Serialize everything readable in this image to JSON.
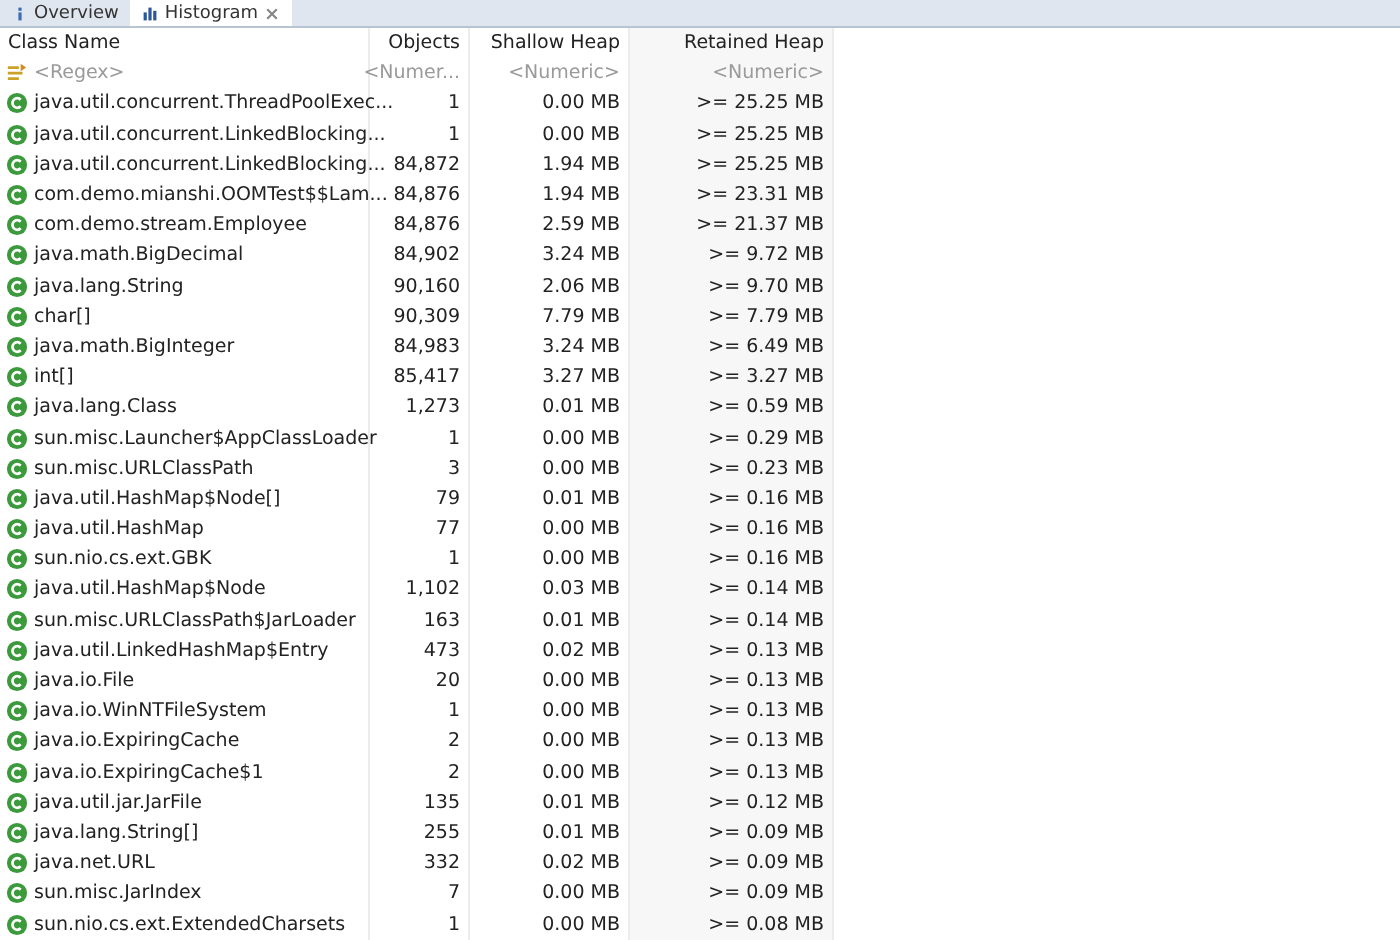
{
  "tabs": [
    {
      "label": "Overview",
      "selected": false,
      "closable": false
    },
    {
      "label": "Histogram",
      "selected": true,
      "closable": true
    }
  ],
  "table": {
    "columns": [
      "Class Name",
      "Objects",
      "Shallow Heap",
      "Retained Heap"
    ],
    "filters": [
      "<Regex>",
      "<Numer...",
      "<Numeric>",
      "<Numeric>"
    ],
    "rows": [
      [
        "java.util.concurrent.ThreadPoolExec...",
        "1",
        "0.00 MB",
        ">= 25.25 MB"
      ],
      [
        "java.util.concurrent.LinkedBlocking...",
        "1",
        "0.00 MB",
        ">= 25.25 MB"
      ],
      [
        "java.util.concurrent.LinkedBlocking...",
        "84,872",
        "1.94 MB",
        ">= 25.25 MB"
      ],
      [
        "com.demo.mianshi.OOMTest$$Lam...",
        "84,876",
        "1.94 MB",
        ">= 23.31 MB"
      ],
      [
        "com.demo.stream.Employee",
        "84,876",
        "2.59 MB",
        ">= 21.37 MB"
      ],
      [
        "java.math.BigDecimal",
        "84,902",
        "3.24 MB",
        ">= 9.72 MB"
      ],
      [
        "java.lang.String",
        "90,160",
        "2.06 MB",
        ">= 9.70 MB"
      ],
      [
        "char[]",
        "90,309",
        "7.79 MB",
        ">= 7.79 MB"
      ],
      [
        "java.math.BigInteger",
        "84,983",
        "3.24 MB",
        ">= 6.49 MB"
      ],
      [
        "int[]",
        "85,417",
        "3.27 MB",
        ">= 3.27 MB"
      ],
      [
        "java.lang.Class",
        "1,273",
        "0.01 MB",
        ">= 0.59 MB"
      ],
      [
        "sun.misc.Launcher$AppClassLoader",
        "1",
        "0.00 MB",
        ">= 0.29 MB"
      ],
      [
        "sun.misc.URLClassPath",
        "3",
        "0.00 MB",
        ">= 0.23 MB"
      ],
      [
        "java.util.HashMap$Node[]",
        "79",
        "0.01 MB",
        ">= 0.16 MB"
      ],
      [
        "java.util.HashMap",
        "77",
        "0.00 MB",
        ">= 0.16 MB"
      ],
      [
        "sun.nio.cs.ext.GBK",
        "1",
        "0.00 MB",
        ">= 0.16 MB"
      ],
      [
        "java.util.HashMap$Node",
        "1,102",
        "0.03 MB",
        ">= 0.14 MB"
      ],
      [
        "sun.misc.URLClassPath$JarLoader",
        "163",
        "0.01 MB",
        ">= 0.14 MB"
      ],
      [
        "java.util.LinkedHashMap$Entry",
        "473",
        "0.02 MB",
        ">= 0.13 MB"
      ],
      [
        "java.io.File",
        "20",
        "0.00 MB",
        ">= 0.13 MB"
      ],
      [
        "java.io.WinNTFileSystem",
        "1",
        "0.00 MB",
        ">= 0.13 MB"
      ],
      [
        "java.io.ExpiringCache",
        "2",
        "0.00 MB",
        ">= 0.13 MB"
      ],
      [
        "java.io.ExpiringCache$1",
        "2",
        "0.00 MB",
        ">= 0.13 MB"
      ],
      [
        "java.util.jar.JarFile",
        "135",
        "0.01 MB",
        ">= 0.12 MB"
      ],
      [
        "java.lang.String[]",
        "255",
        "0.01 MB",
        ">= 0.09 MB"
      ],
      [
        "java.net.URL",
        "332",
        "0.02 MB",
        ">= 0.09 MB"
      ],
      [
        "sun.misc.JarIndex",
        "7",
        "0.00 MB",
        ">= 0.09 MB"
      ],
      [
        "sun.nio.cs.ext.ExtendedCharsets",
        "1",
        "0.00 MB",
        ">= 0.08 MB"
      ]
    ]
  }
}
